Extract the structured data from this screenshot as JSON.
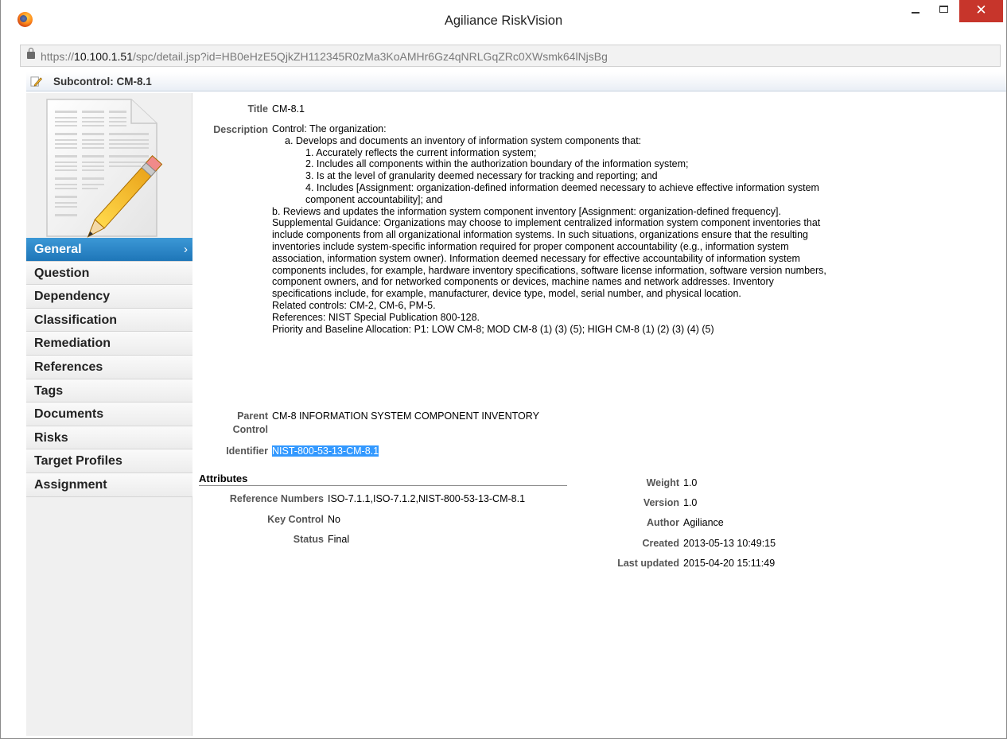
{
  "window": {
    "title": "Agiliance RiskVision",
    "close_glyph": "✕"
  },
  "address_bar": {
    "url_prefix": "https://",
    "url_host": "10.100.1.51",
    "url_path": "/spc/detail.jsp?id=HB0eHzE5QjkZH112345R0zMa3KoAMHr6Gz4qNRLGqZRc0XWsmk64lNjsBg"
  },
  "header": {
    "title": "Subcontrol: CM-8.1"
  },
  "sidebar": {
    "items": [
      {
        "label": "General",
        "active": true
      },
      {
        "label": "Question",
        "active": false
      },
      {
        "label": "Dependency",
        "active": false
      },
      {
        "label": "Classification",
        "active": false
      },
      {
        "label": "Remediation",
        "active": false
      },
      {
        "label": "References",
        "active": false
      },
      {
        "label": "Tags",
        "active": false
      },
      {
        "label": "Documents",
        "active": false
      },
      {
        "label": "Risks",
        "active": false
      },
      {
        "label": "Target Profiles",
        "active": false
      },
      {
        "label": "Assignment",
        "active": false
      }
    ],
    "active_chevron": "›"
  },
  "general": {
    "title_label": "Title",
    "title_value": "CM-8.1",
    "description_label": "Description",
    "description_lines": [
      "Control: The organization:",
      "a. Develops and documents an inventory of information system components that:",
      "1. Accurately reflects the current information system;",
      "2. Includes all components within the authorization boundary of the information system;",
      "3. Is at the level of granularity deemed necessary for tracking and reporting; and",
      "4. Includes [Assignment: organization-defined information deemed necessary to achieve effective information system",
      "component accountability]; and",
      "b. Reviews and updates the information system component inventory [Assignment: organization-defined frequency].",
      "Supplemental Guidance: Organizations may choose to implement centralized information system component inventories that",
      "include components from all organizational information systems. In such situations, organizations ensure that the resulting",
      "inventories include system-specific information required for proper component accountability (e.g., information system",
      "association, information system owner). Information deemed necessary for effective accountability of information system",
      "components includes, for example, hardware inventory specifications, software license information, software version numbers,",
      "component owners, and for networked components or devices, machine names and network addresses. Inventory",
      "specifications include, for example, manufacturer, device type, model, serial number, and physical location.",
      "Related controls: CM-2, CM-6, PM-5.",
      "References: NIST Special Publication 800-128.",
      "Priority and Baseline Allocation: P1: LOW CM-8; MOD CM-8 (1) (3) (5); HIGH CM-8 (1) (2) (3) (4) (5)"
    ],
    "parent_label_1": "Parent",
    "parent_label_2": "Control",
    "parent_value": "CM-8 INFORMATION SYSTEM COMPONENT INVENTORY",
    "identifier_label": "Identifier",
    "identifier_value": "NIST-800-53-13-CM-8.1"
  },
  "attributes": {
    "heading": "Attributes",
    "left": [
      {
        "label": "Reference Numbers",
        "value": "ISO-7.1.1,ISO-7.1.2,NIST-800-53-13-CM-8.1"
      },
      {
        "label": "Key Control",
        "value": "No"
      },
      {
        "label": "Status",
        "value": "Final"
      }
    ],
    "right": [
      {
        "label": "Weight",
        "value": "1.0"
      },
      {
        "label": "Version",
        "value": "1.0"
      },
      {
        "label": "Author",
        "value": "Agiliance"
      },
      {
        "label": "Created",
        "value": "2013-05-13 10:49:15"
      },
      {
        "label": "Last updated",
        "value": "2015-04-20 15:11:49"
      }
    ]
  }
}
